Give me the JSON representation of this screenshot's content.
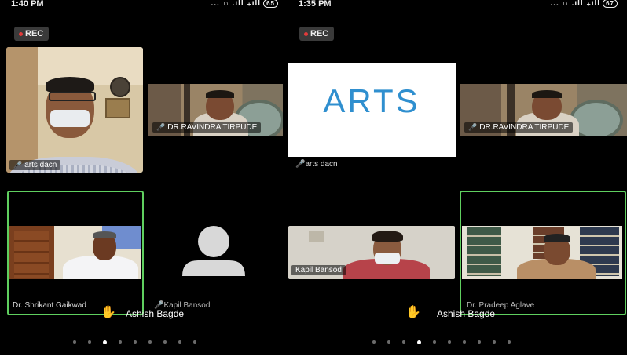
{
  "screens": [
    {
      "status": {
        "time": "1:40 PM",
        "icons": "... ∩ .ıll ₊ıll",
        "battery": "65"
      },
      "rec": "REC",
      "tiles": {
        "arts_dacn": "arts dacn",
        "ravindra": "DR.RAVINDRA TIRPUDE",
        "shrikant": "Dr. Shrikant Gaikwad",
        "kapil": "Kapil Bansod"
      },
      "raised_hand": "Ashish Bagde"
    },
    {
      "status": {
        "time": "1:35 PM",
        "icons": "... ∩ .ıll ₊ıll",
        "battery": "67"
      },
      "rec": "REC",
      "tiles": {
        "arts_logo": "ARTS",
        "arts_dacn": "arts dacn",
        "ravindra": "DR.RAVINDRA TIRPUDE",
        "kapil": "Kapil Bansod",
        "pradeep": "Dr. Pradeep Aglave"
      },
      "raised_hand": "Ashish Bagde"
    }
  ],
  "icons": {
    "hand": "raised-hand-icon",
    "mic": "mic-icon",
    "avatar": "avatar-placeholder-icon"
  },
  "colors": {
    "active_border": "#5fcf5f",
    "rec_dot": "#e23b3b",
    "hand": "#f2c12a",
    "arts_text": "#2f8fcf"
  }
}
